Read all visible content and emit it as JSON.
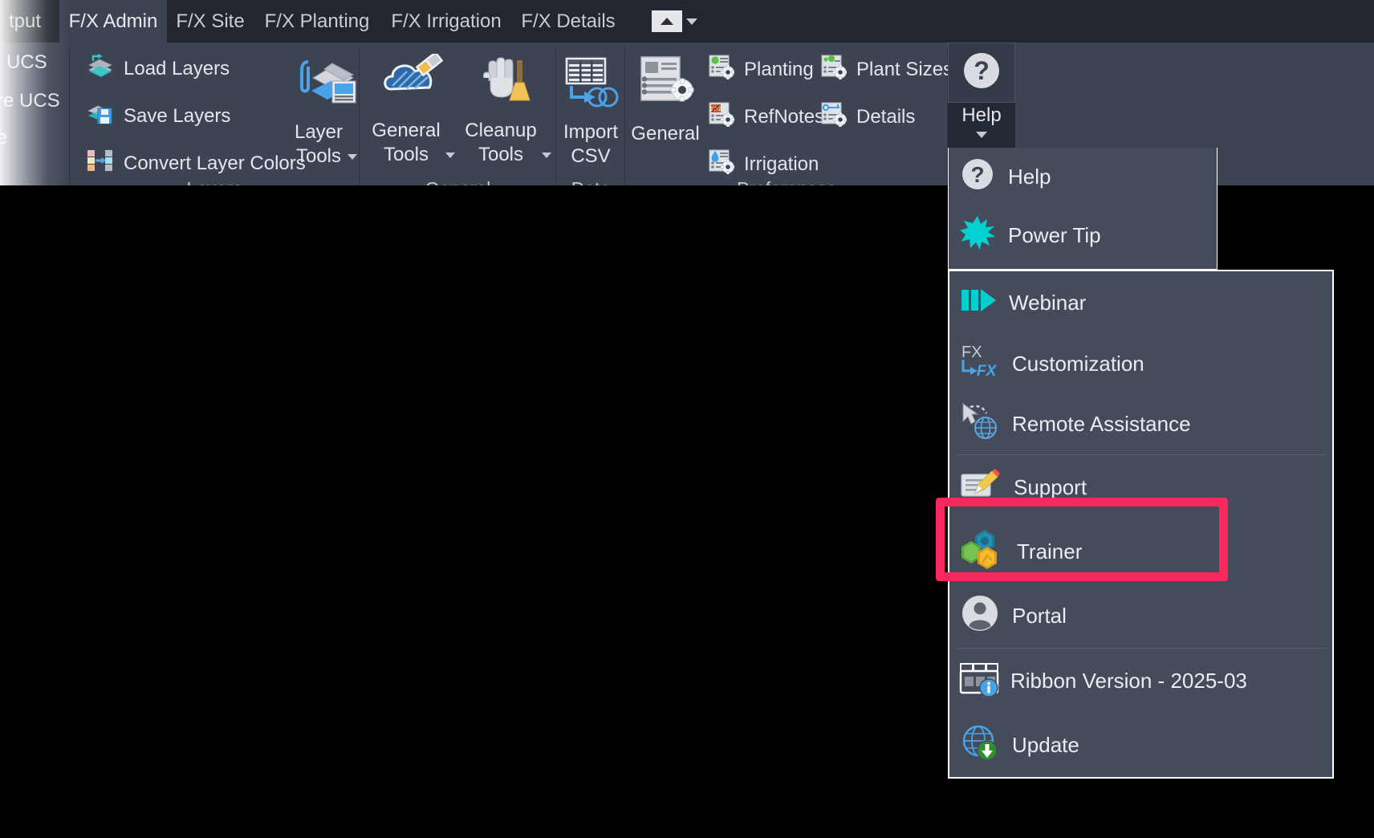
{
  "app": {
    "theme_bg": "#3c4454",
    "tabstrip_bg": "#22272f",
    "accent_highlight": "#f8285f",
    "canvas_bg": "#000000"
  },
  "tabstrip": {
    "tabs": [
      {
        "label": "tput",
        "active": false
      },
      {
        "label": "F/X Admin",
        "active": true
      },
      {
        "label": "F/X Site",
        "active": false
      },
      {
        "label": "F/X Planting",
        "active": false
      },
      {
        "label": "F/X Irrigation",
        "active": false
      },
      {
        "label": "F/X Details",
        "active": false
      }
    ],
    "overflow_icon": "triangle-up-icon",
    "overflow_caret": "chevron-down-icon"
  },
  "left_stubs": [
    {
      "label": "UCS"
    },
    {
      "label": "re UCS"
    },
    {
      "label": "e"
    }
  ],
  "panels": [
    {
      "name": "Layers",
      "label": "Layers",
      "small_buttons": [
        {
          "label": "Load Layers",
          "icon": "load-layers-icon"
        },
        {
          "label": "Save Layers",
          "icon": "save-layers-icon"
        },
        {
          "label": "Convert Layer Colors",
          "icon": "convert-layer-colors-icon"
        }
      ],
      "large_buttons": [
        {
          "label_line1": "Layer",
          "label_line2": "Tools",
          "icon": "layer-tools-icon",
          "has_dropdown": true
        }
      ]
    },
    {
      "name": "General",
      "label": "General",
      "small_buttons": [],
      "large_buttons": [
        {
          "label_line1": "General",
          "label_line2": "Tools",
          "icon": "general-tools-icon",
          "has_dropdown": true
        },
        {
          "label_line1": "Cleanup",
          "label_line2": "Tools",
          "icon": "cleanup-tools-icon",
          "has_dropdown": true
        }
      ]
    },
    {
      "name": "Data",
      "label": "Data",
      "small_buttons": [],
      "large_buttons": [
        {
          "label_line1": "Import",
          "label_line2": "CSV",
          "icon": "import-csv-icon",
          "has_dropdown": false
        }
      ]
    },
    {
      "name": "Preferences",
      "label": "Preferences",
      "small_buttons": [
        {
          "label": "Planting",
          "icon": "planting-prefs-icon"
        },
        {
          "label": "RefNotes",
          "icon": "refnotes-prefs-icon"
        },
        {
          "label": "Irrigation",
          "icon": "irrigation-prefs-icon"
        },
        {
          "label": "Plant Sizes",
          "icon": "plant-sizes-prefs-icon"
        },
        {
          "label": "Details",
          "icon": "details-prefs-icon"
        }
      ],
      "large_buttons": [
        {
          "label_line1": "General",
          "label_line2": "",
          "icon": "general-prefs-icon",
          "has_dropdown": false
        }
      ]
    }
  ],
  "help_button": {
    "label": "Help",
    "icon": "help-question-icon",
    "caret": "chevron-down-icon",
    "expanded": true
  },
  "help_menu": {
    "groups": [
      {
        "items": [
          {
            "label": "Help",
            "icon": "help-question-icon",
            "highlighted": false
          },
          {
            "label": "Power Tip",
            "icon": "power-tip-starburst-icon",
            "highlighted": false
          },
          {
            "label": "Webinar",
            "icon": "webinar-play-icon",
            "highlighted": false
          },
          {
            "label": "Customization",
            "icon": "fx-customization-icon",
            "highlighted": false
          },
          {
            "label": "Remote Assistance",
            "icon": "remote-assistance-cursor-globe-icon",
            "highlighted": false
          }
        ]
      },
      {
        "items": [
          {
            "label": "Support",
            "icon": "support-pencil-form-icon",
            "highlighted": false
          },
          {
            "label": "Trainer",
            "icon": "trainer-hexagons-icon",
            "highlighted": true
          },
          {
            "label": "Portal",
            "icon": "portal-person-icon",
            "highlighted": false
          }
        ]
      },
      {
        "items": [
          {
            "label": "Ribbon Version - 2025-03",
            "icon": "ribbon-version-info-icon",
            "highlighted": false
          },
          {
            "label": "Update",
            "icon": "update-globe-download-icon",
            "highlighted": false
          }
        ]
      }
    ]
  }
}
